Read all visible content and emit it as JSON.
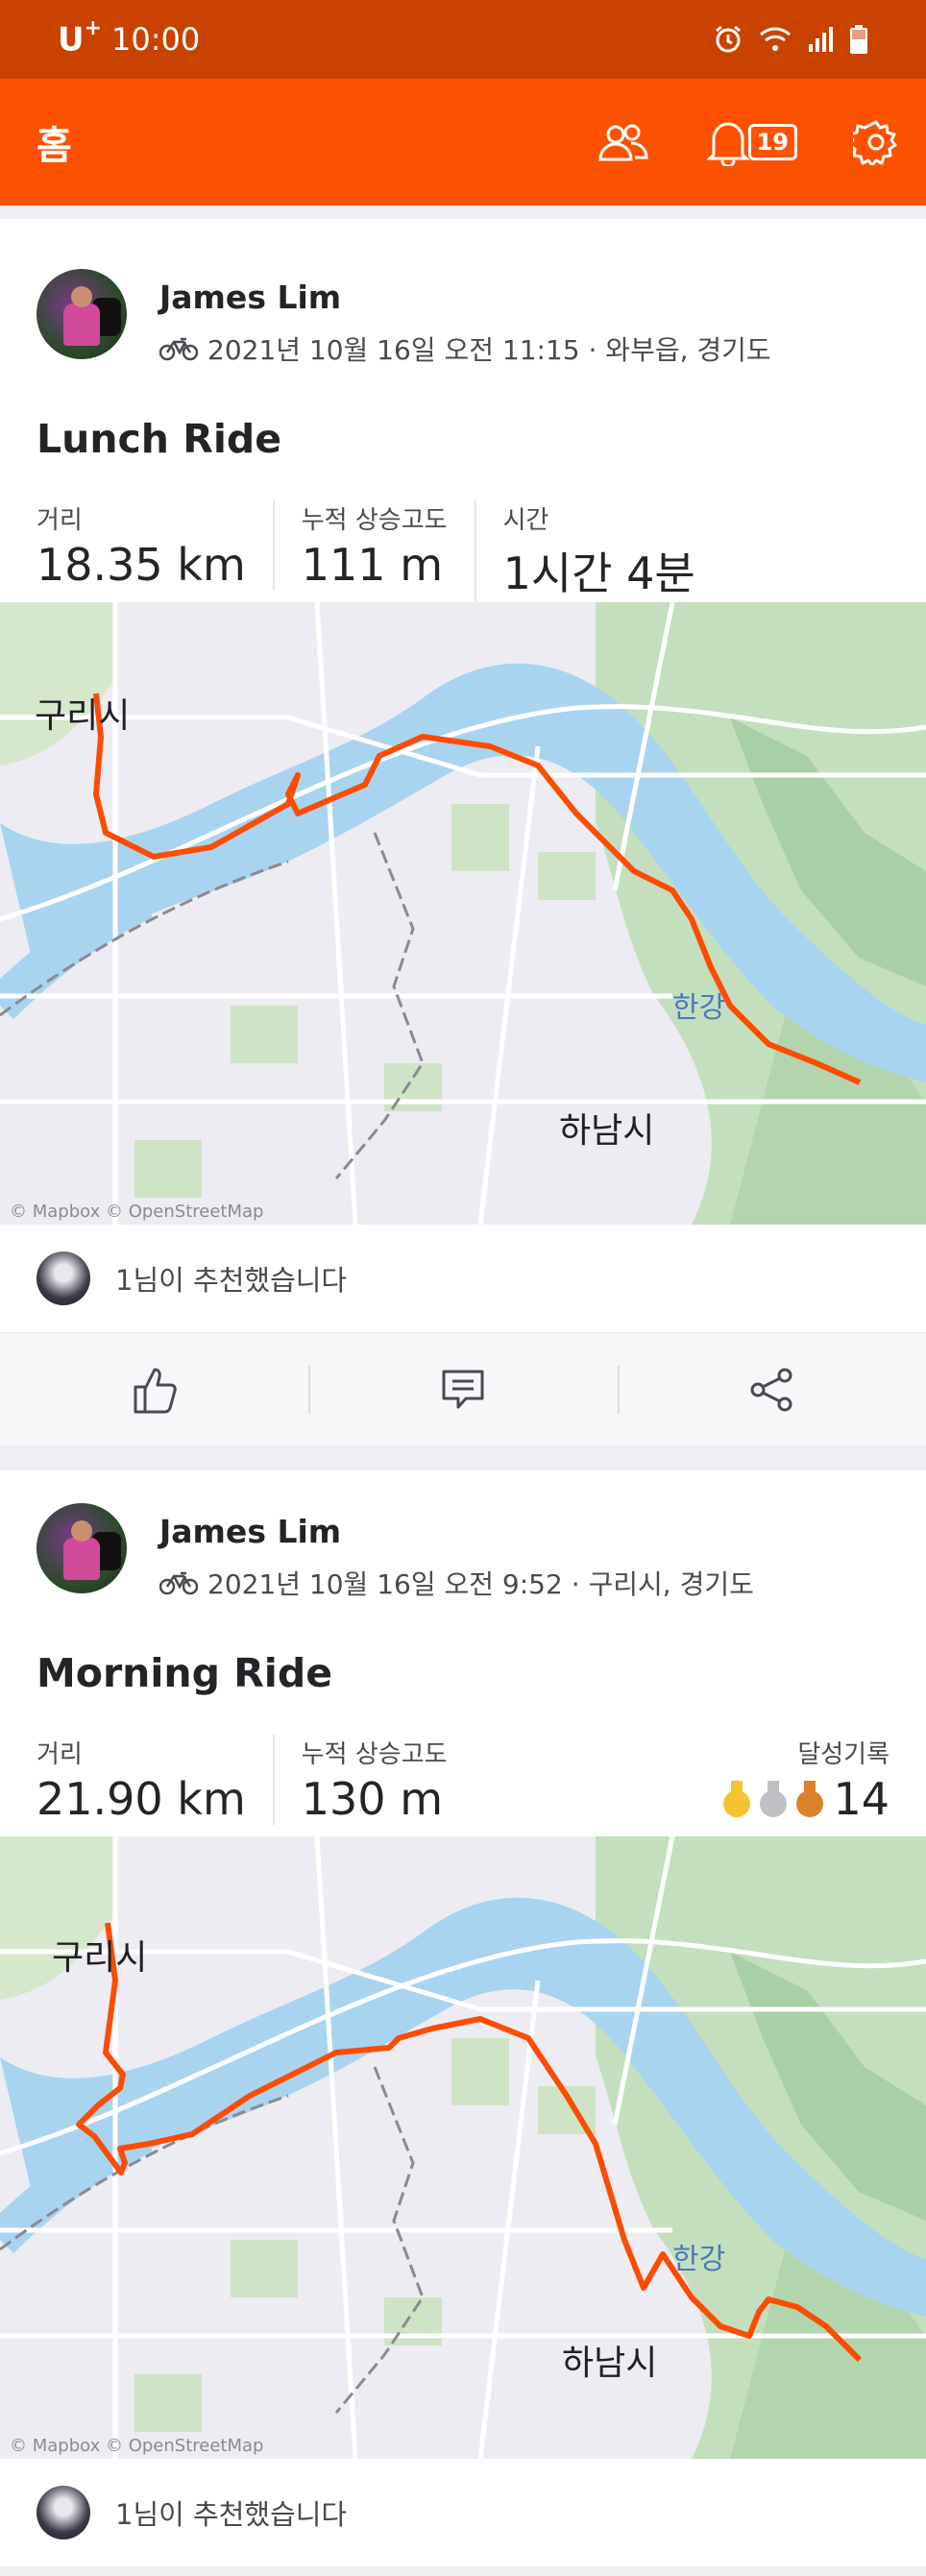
{
  "status_bar": {
    "carrier": "U",
    "carrier_super": "+",
    "time": "10:00"
  },
  "app_bar": {
    "title": "홈",
    "notification_count": "19"
  },
  "activities": [
    {
      "athlete": "James Lim",
      "date_location": "2021년 10월 16일 오전 11:15 · 와부읍, 경기도",
      "title": "Lunch Ride",
      "stats": [
        {
          "label": "거리",
          "value": "18.35 km"
        },
        {
          "label": "누적 상승고도",
          "value": "111 m"
        },
        {
          "label": "시간",
          "value": "1시간 4분"
        }
      ],
      "map_labels": {
        "city_guri": "구리시",
        "river": "한강",
        "city_hanam": "하남시",
        "attribution": "© Mapbox © OpenStreetMap"
      },
      "kudos_text": "1님이 추천했습니다"
    },
    {
      "athlete": "James Lim",
      "date_location": "2021년 10월 16일 오전 9:52 · 구리시, 경기도",
      "title": "Morning Ride",
      "stats": [
        {
          "label": "거리",
          "value": "21.90 km"
        },
        {
          "label": "누적 상승고도",
          "value": "130 m"
        }
      ],
      "achievements": {
        "label": "달성기록",
        "count": "14",
        "medal_colors": [
          "#f4c430",
          "#c0c0c4",
          "#d9822b"
        ]
      },
      "map_labels": {
        "city_guri": "구리시",
        "river": "한강",
        "city_hanam": "하남시",
        "attribution": "© Mapbox © OpenStreetMap"
      },
      "kudos_text": "1님이 추천했습니다"
    }
  ],
  "colors": {
    "brand": "#fc5200",
    "status_bar": "#c94200",
    "route": "#fc4c02",
    "river": "#a8d4f0",
    "land": "#ececf2"
  }
}
